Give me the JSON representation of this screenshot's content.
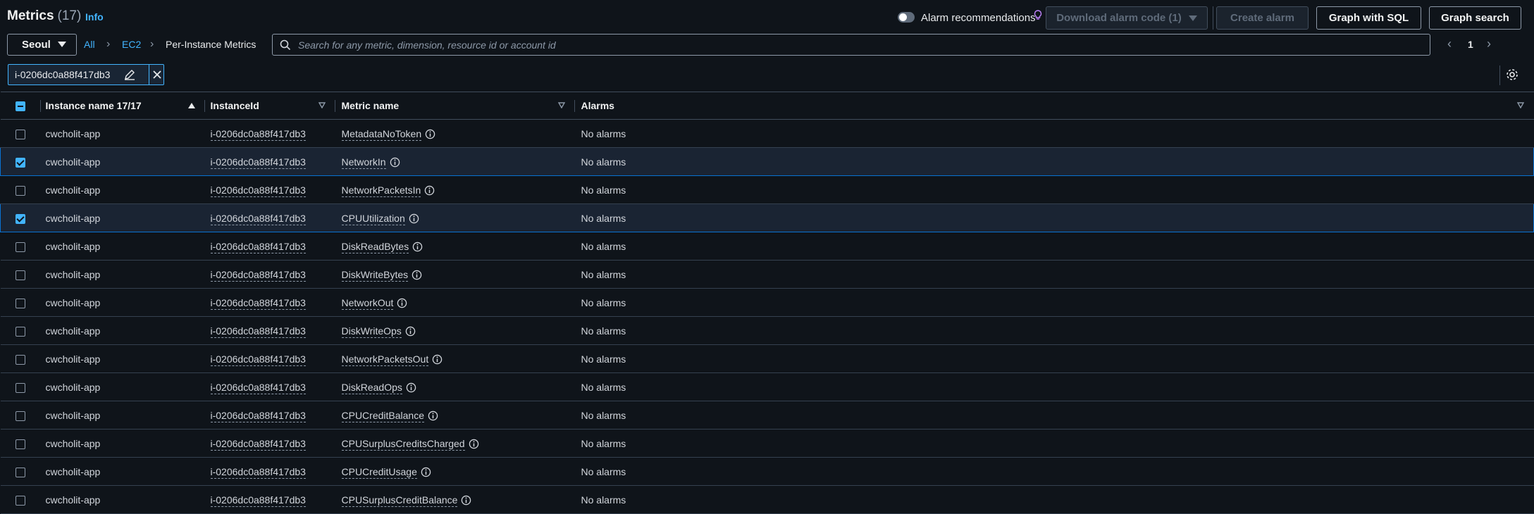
{
  "header": {
    "title": "Metrics",
    "count": "(17)",
    "info_label": "Info",
    "alarm_recommendations_label": "Alarm recommendations",
    "download_alarm_code_label": "Download alarm code (1)",
    "create_alarm_label": "Create alarm",
    "graph_sql_label": "Graph with SQL",
    "graph_search_label": "Graph search"
  },
  "nav": {
    "region": "Seoul",
    "breadcrumb": [
      "All",
      "EC2",
      "Per-Instance Metrics"
    ]
  },
  "search": {
    "placeholder": "Search for any metric, dimension, resource id or account id"
  },
  "pager": {
    "page": "1"
  },
  "filter_token": {
    "label": "i-0206dc0a88f417db3"
  },
  "table": {
    "columns": [
      "Instance name 17/17",
      "InstanceId",
      "Metric name",
      "Alarms"
    ],
    "rows": [
      {
        "instance": "cwcholit-app",
        "id": "i-0206dc0a88f417db3",
        "metric": "MetadataNoToken",
        "alarms": "No alarms",
        "selected": false
      },
      {
        "instance": "cwcholit-app",
        "id": "i-0206dc0a88f417db3",
        "metric": "NetworkIn",
        "alarms": "No alarms",
        "selected": true
      },
      {
        "instance": "cwcholit-app",
        "id": "i-0206dc0a88f417db3",
        "metric": "NetworkPacketsIn",
        "alarms": "No alarms",
        "selected": false
      },
      {
        "instance": "cwcholit-app",
        "id": "i-0206dc0a88f417db3",
        "metric": "CPUUtilization",
        "alarms": "No alarms",
        "selected": true
      },
      {
        "instance": "cwcholit-app",
        "id": "i-0206dc0a88f417db3",
        "metric": "DiskReadBytes",
        "alarms": "No alarms",
        "selected": false
      },
      {
        "instance": "cwcholit-app",
        "id": "i-0206dc0a88f417db3",
        "metric": "DiskWriteBytes",
        "alarms": "No alarms",
        "selected": false
      },
      {
        "instance": "cwcholit-app",
        "id": "i-0206dc0a88f417db3",
        "metric": "NetworkOut",
        "alarms": "No alarms",
        "selected": false
      },
      {
        "instance": "cwcholit-app",
        "id": "i-0206dc0a88f417db3",
        "metric": "DiskWriteOps",
        "alarms": "No alarms",
        "selected": false
      },
      {
        "instance": "cwcholit-app",
        "id": "i-0206dc0a88f417db3",
        "metric": "NetworkPacketsOut",
        "alarms": "No alarms",
        "selected": false
      },
      {
        "instance": "cwcholit-app",
        "id": "i-0206dc0a88f417db3",
        "metric": "DiskReadOps",
        "alarms": "No alarms",
        "selected": false
      },
      {
        "instance": "cwcholit-app",
        "id": "i-0206dc0a88f417db3",
        "metric": "CPUCreditBalance",
        "alarms": "No alarms",
        "selected": false
      },
      {
        "instance": "cwcholit-app",
        "id": "i-0206dc0a88f417db3",
        "metric": "CPUSurplusCreditsCharged",
        "alarms": "No alarms",
        "selected": false
      },
      {
        "instance": "cwcholit-app",
        "id": "i-0206dc0a88f417db3",
        "metric": "CPUCreditUsage",
        "alarms": "No alarms",
        "selected": false
      },
      {
        "instance": "cwcholit-app",
        "id": "i-0206dc0a88f417db3",
        "metric": "CPUSurplusCreditBalance",
        "alarms": "No alarms",
        "selected": false
      }
    ]
  },
  "colors": {
    "background": "#0f141a",
    "accent": "#42b4ff",
    "selected_row": "#1a2433"
  }
}
